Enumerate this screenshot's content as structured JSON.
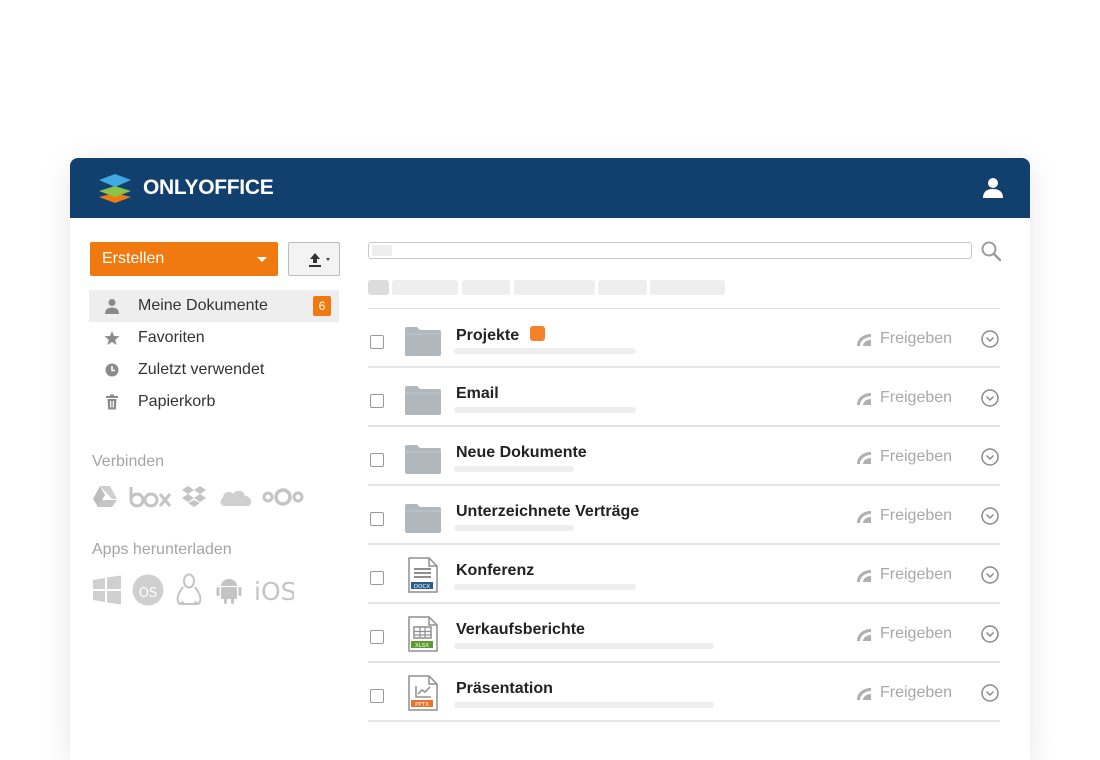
{
  "header": {
    "brand": "ONLYOFFICE"
  },
  "toolbar": {
    "create_label": "Erstellen"
  },
  "nav": [
    {
      "label": "Meine Dokumente",
      "icon": "user-icon",
      "badge": "6",
      "active": true
    },
    {
      "label": "Favoriten",
      "icon": "star-icon"
    },
    {
      "label": "Zuletzt verwendet",
      "icon": "clock-icon"
    },
    {
      "label": "Papierkorb",
      "icon": "trash-icon"
    }
  ],
  "connect": {
    "label": "Verbinden",
    "services": [
      "google-drive-icon",
      "box-icon",
      "dropbox-icon",
      "onedrive-icon",
      "nextcloud-icon"
    ]
  },
  "apps": {
    "label": "Apps herunterladen",
    "platforms": [
      "windows-icon",
      "macos-icon",
      "linux-icon",
      "android-icon",
      "ios-icon"
    ]
  },
  "files": [
    {
      "name": "Projekte",
      "type": "folder",
      "tagged": true,
      "share": "Freigeben"
    },
    {
      "name": "Email",
      "type": "folder",
      "share": "Freigeben"
    },
    {
      "name": "Neue Dokumente",
      "type": "folder",
      "share": "Freigeben"
    },
    {
      "name": "Unterzeichnete Verträge",
      "type": "folder",
      "share": "Freigeben"
    },
    {
      "name": "Konferenz",
      "type": "docx",
      "ext": "DOCX",
      "share": "Freigeben"
    },
    {
      "name": "Verkaufsberichte",
      "type": "xlsx",
      "ext": "XLSX",
      "share": "Freigeben"
    },
    {
      "name": "Präsentation",
      "type": "pptx",
      "ext": "PPTX",
      "share": "Freigeben"
    }
  ],
  "colors": {
    "header": "#12406e",
    "accent": "#f07a0f",
    "docx": "#2b5d8c",
    "xlsx": "#5c9b2c",
    "pptx": "#e8722b"
  }
}
